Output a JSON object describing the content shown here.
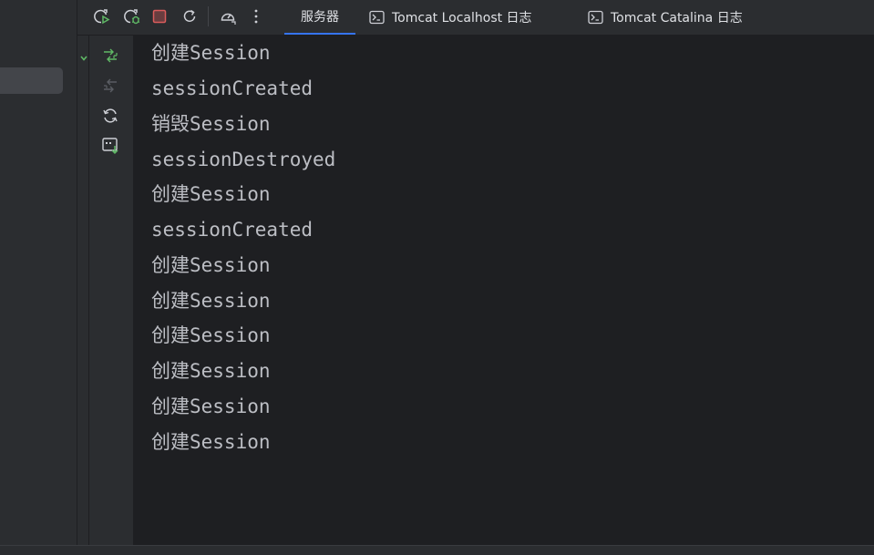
{
  "toolbar": {
    "buttons": [
      {
        "name": "rerun-icon"
      },
      {
        "name": "debug-rerun-icon"
      },
      {
        "name": "stop-icon"
      },
      {
        "name": "refresh-icon"
      },
      {
        "name": "dashboard-icon"
      },
      {
        "name": "more-icon"
      }
    ],
    "tabs": [
      {
        "label": "服务器",
        "active": true
      },
      {
        "label": "Tomcat Localhost 日志",
        "active": false
      },
      {
        "label": "Tomcat Catalina 日志",
        "active": false
      }
    ]
  },
  "action_strip": {
    "buttons": [
      {
        "name": "scroll-to-end-icon",
        "enabled": true
      },
      {
        "name": "scroll-to-start-icon",
        "enabled": false
      },
      {
        "name": "soft-wrap-icon",
        "enabled": true
      },
      {
        "name": "save-output-icon",
        "enabled": true
      }
    ]
  },
  "console": {
    "lines": [
      "创建Session",
      "sessionCreated",
      "销毁Session",
      "sessionDestroyed",
      "创建Session",
      "sessionCreated",
      "创建Session",
      "创建Session",
      "创建Session",
      "创建Session",
      "创建Session",
      "创建Session"
    ]
  },
  "colors": {
    "run_green": "#5fb865",
    "stop_red": "#db5c5c",
    "icon_gray": "#ced0d6",
    "accent_blue": "#3574f0",
    "console_text": "#bcbec4"
  }
}
